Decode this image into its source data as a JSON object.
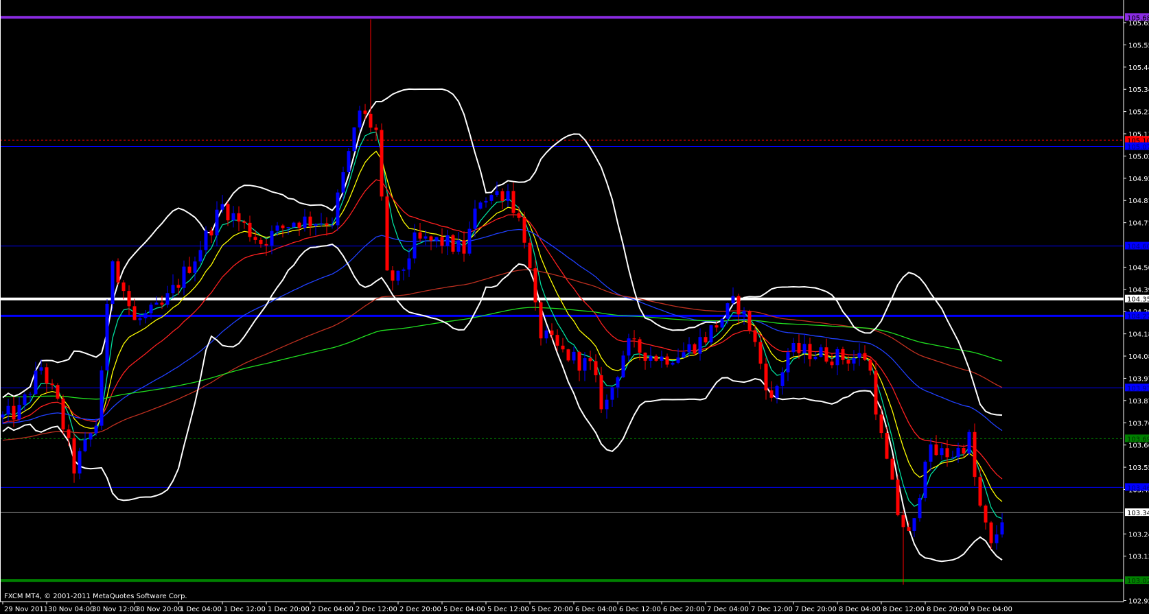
{
  "window": {
    "copyright": "FXCM MT4, © 2001-2011 MetaQuotes Software Corp."
  },
  "colors": {
    "background": "#000000",
    "bull": "#0000ff",
    "bear": "#ff0000",
    "axis": "#ffffff"
  },
  "chart_data": {
    "type": "candlestick",
    "timeframe_hours_per_bar": 1,
    "ylim": [
      102.925,
      105.68
    ],
    "yaxis_ticks": [
      "105.655",
      "105.550",
      "105.445",
      "105.340",
      "105.235",
      "105.130",
      "105.025",
      "104.920",
      "104.815",
      "104.710",
      "104.500",
      "104.395",
      "104.290",
      "104.185",
      "104.080",
      "103.975",
      "103.870",
      "103.765",
      "103.660",
      "103.555",
      "103.450",
      "103.240",
      "103.135",
      "102.925"
    ],
    "xaxis_ticks": [
      {
        "bar": 0,
        "label": "29 Nov 2011"
      },
      {
        "bar": 8,
        "label": "30 Nov 04:00"
      },
      {
        "bar": 16,
        "label": "30 Nov 12:00"
      },
      {
        "bar": 24,
        "label": "30 Nov 20:00"
      },
      {
        "bar": 32,
        "label": "1 Dec 04:00"
      },
      {
        "bar": 40,
        "label": "1 Dec 12:00"
      },
      {
        "bar": 48,
        "label": "1 Dec 20:00"
      },
      {
        "bar": 56,
        "label": "2 Dec 04:00"
      },
      {
        "bar": 64,
        "label": "2 Dec 12:00"
      },
      {
        "bar": 72,
        "label": "2 Dec 20:00"
      },
      {
        "bar": 80,
        "label": "5 Dec 04:00"
      },
      {
        "bar": 88,
        "label": "5 Dec 12:00"
      },
      {
        "bar": 96,
        "label": "5 Dec 20:00"
      },
      {
        "bar": 104,
        "label": "6 Dec 04:00"
      },
      {
        "bar": 112,
        "label": "6 Dec 12:00"
      },
      {
        "bar": 120,
        "label": "6 Dec 20:00"
      },
      {
        "bar": 128,
        "label": "7 Dec 04:00"
      },
      {
        "bar": 136,
        "label": "7 Dec 12:00"
      },
      {
        "bar": 144,
        "label": "7 Dec 20:00"
      },
      {
        "bar": 152,
        "label": "8 Dec 04:00"
      },
      {
        "bar": 160,
        "label": "8 Dec 12:00"
      },
      {
        "bar": 168,
        "label": "8 Dec 20:00"
      },
      {
        "bar": 176,
        "label": "9 Dec 04:00"
      }
    ],
    "close_anchors": [
      [
        0,
        103.79
      ],
      [
        3,
        103.82
      ],
      [
        7,
        104.03
      ],
      [
        10,
        103.85
      ],
      [
        13,
        103.55
      ],
      [
        17,
        103.76
      ],
      [
        20,
        104.55
      ],
      [
        24,
        104.24
      ],
      [
        29,
        104.31
      ],
      [
        35,
        104.55
      ],
      [
        40,
        104.79
      ],
      [
        47,
        104.62
      ],
      [
        53,
        104.72
      ],
      [
        60,
        104.72
      ],
      [
        65,
        105.24
      ],
      [
        68,
        105.14
      ],
      [
        70,
        104.45
      ],
      [
        72,
        104.44
      ],
      [
        75,
        104.62
      ],
      [
        80,
        104.62
      ],
      [
        84,
        104.58
      ],
      [
        87,
        104.83
      ],
      [
        92,
        104.86
      ],
      [
        95,
        104.65
      ],
      [
        97.5,
        104.2
      ],
      [
        101.5,
        104.1
      ],
      [
        107,
        104.03
      ],
      [
        109.5,
        103.82
      ],
      [
        113.5,
        104.13
      ],
      [
        120,
        104.07
      ],
      [
        124,
        104.1
      ],
      [
        128,
        104.17
      ],
      [
        133.5,
        104.34
      ],
      [
        136,
        104.22
      ],
      [
        139,
        103.96
      ],
      [
        140,
        103.86
      ],
      [
        143,
        104.1
      ],
      [
        147,
        104.1
      ],
      [
        153.5,
        104.07
      ],
      [
        157.5,
        104.08
      ],
      [
        160,
        103.69
      ],
      [
        163,
        103.34
      ],
      [
        165.5,
        103.2
      ],
      [
        168,
        103.62
      ],
      [
        173.5,
        103.62
      ],
      [
        176,
        103.69
      ],
      [
        177.5,
        103.41
      ],
      [
        180,
        103.17
      ],
      [
        182,
        103.32
      ]
    ],
    "wick_extremes": [
      {
        "bar": 67,
        "high": 105.67
      },
      {
        "bar": 164,
        "low": 103.0
      }
    ],
    "indicators": [
      {
        "name": "EMA 5",
        "period": 5,
        "color": "#00e0a0",
        "seed": 103.79
      },
      {
        "name": "EMA 10",
        "period": 10,
        "color": "#ffff00",
        "seed": 103.78
      },
      {
        "name": "EMA 20",
        "period": 20,
        "color": "#ff2020",
        "seed": 103.76
      },
      {
        "name": "EMA 50",
        "period": 50,
        "color": "#2040ff",
        "seed": 103.76
      },
      {
        "name": "EMA 100",
        "period": 100,
        "color": "#c03020",
        "seed": 103.68
      },
      {
        "name": "EMA 200",
        "period": 200,
        "color": "#20e020",
        "seed": 103.89
      },
      {
        "name": "Bollinger Bands",
        "period": 20,
        "deviation": 2,
        "color": "#ffffff"
      }
    ],
    "levels": [
      {
        "price": 105.68,
        "label": "105.680",
        "color": "#8a2be2",
        "style": "thick",
        "text": "#000000"
      },
      {
        "price": 105.1,
        "label": "105.100",
        "color": "#ff0000",
        "style": "dashed",
        "text": "#000000"
      },
      {
        "price": 105.07,
        "label": "105.070",
        "color": "#0000ff",
        "style": "solid",
        "text": "#000080"
      },
      {
        "price": 104.6,
        "label": "104.600",
        "color": "#0000ff",
        "style": "solid",
        "text": "#000080"
      },
      {
        "price": 104.35,
        "label": "104.350",
        "color": "#ffffff",
        "style": "thick",
        "text": "#000000"
      },
      {
        "price": 104.27,
        "label": "104.270",
        "color": "#0000ff",
        "style": "medium",
        "text": "#000080"
      },
      {
        "price": 103.93,
        "label": "103.930",
        "color": "#0000ff",
        "style": "solid",
        "text": "#000080"
      },
      {
        "price": 103.69,
        "label": "103.690",
        "color": "#008000",
        "style": "dashed",
        "text": "#003000"
      },
      {
        "price": 103.46,
        "label": "103.460",
        "color": "#0000ff",
        "style": "solid",
        "text": "#000080"
      },
      {
        "price": 103.341,
        "label": "103.341",
        "color": "#a0a0a0",
        "style": "solid",
        "text": "#000000",
        "box": "#ffffff"
      },
      {
        "price": 103.02,
        "label": "103.020",
        "color": "#008000",
        "style": "thick",
        "text": "#003000"
      }
    ]
  }
}
